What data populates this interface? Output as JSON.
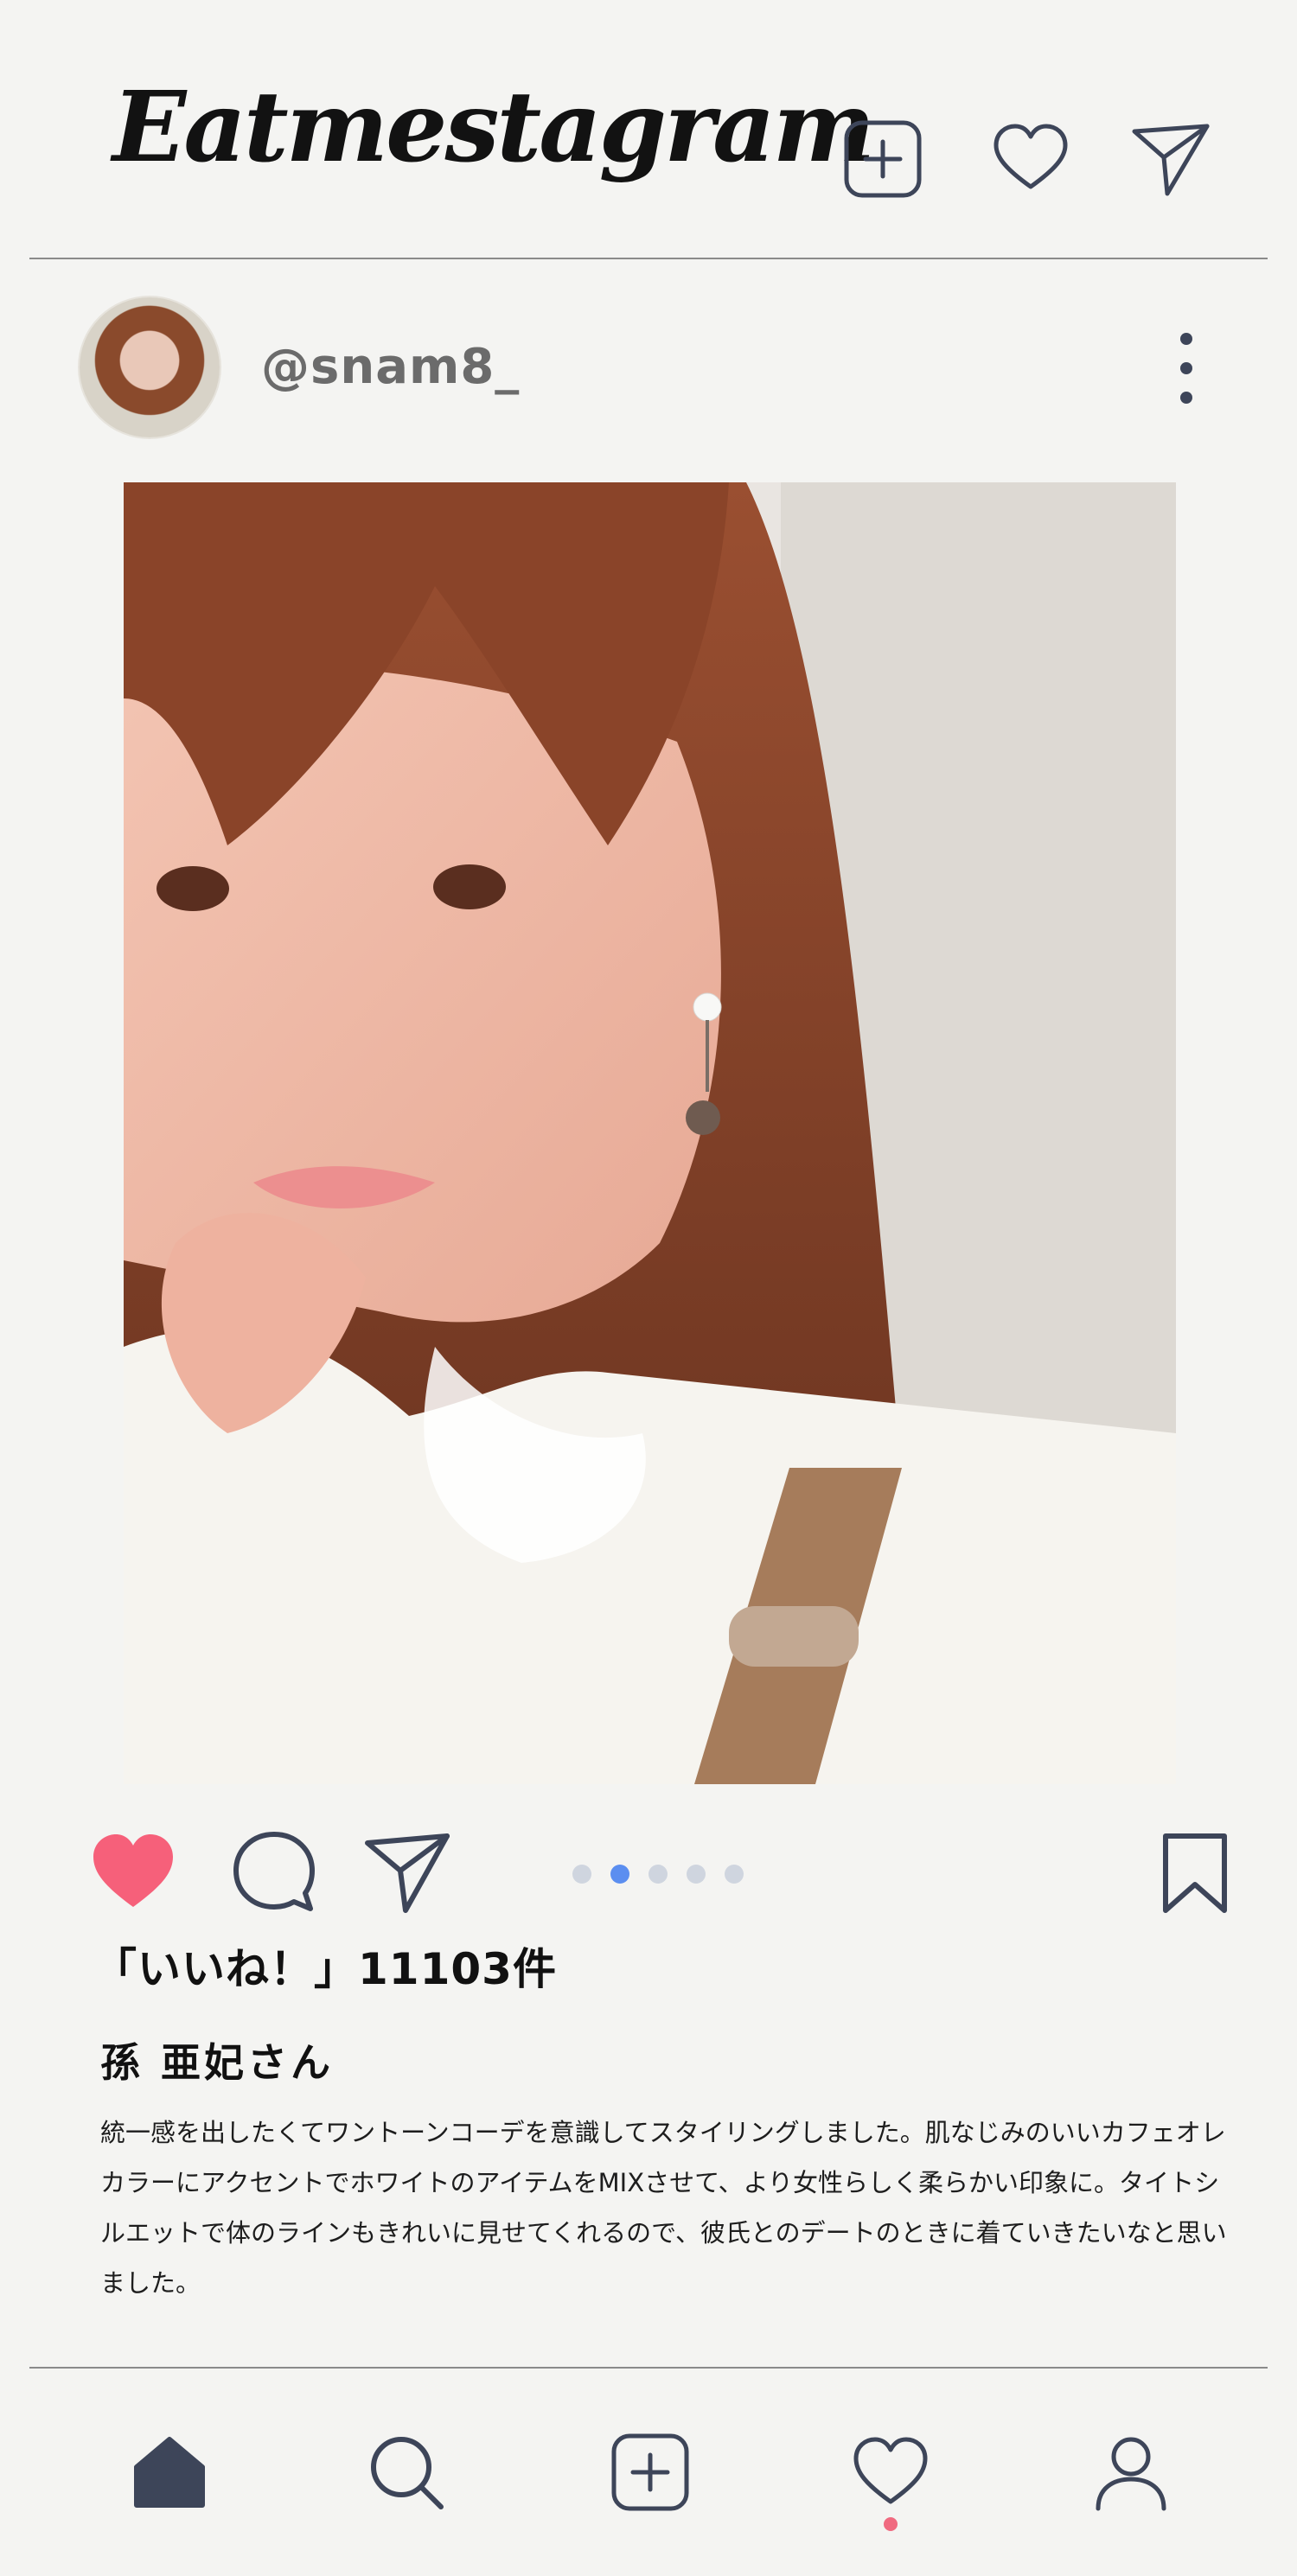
{
  "app": {
    "title": "Eatmestagram"
  },
  "header": {
    "icons": [
      "add-post-icon",
      "heart-icon",
      "send-icon"
    ]
  },
  "post": {
    "username": "@snam8_",
    "likes_text": "「いいね！」11103件",
    "author": "孫 亜妃さん",
    "caption": "統一感を出したくてワントーンコーデを意識してスタイリングしました。肌なじみのいいカフェオレカラーにアクセントでホワイトのアイテムをMIXさせて、より女性らしく柔らかい印象に。タイトシルエットで体のラインもきれいに見せてくれるので、彼氏とのデートのときに着ていきたいなと思いました。",
    "carousel": {
      "total": 5,
      "active_index": 1
    },
    "liked": true
  },
  "bottom_nav": {
    "items": [
      "home-icon",
      "search-icon",
      "add-post-icon",
      "activity-heart-icon",
      "profile-icon"
    ],
    "active": "home"
  },
  "colors": {
    "background": "#f4f4f2",
    "icon": "#3d4559",
    "like": "#f6607a",
    "dot_active": "#5b8ef0",
    "dot_inactive": "#cfd5df",
    "notification": "#f06a80"
  }
}
